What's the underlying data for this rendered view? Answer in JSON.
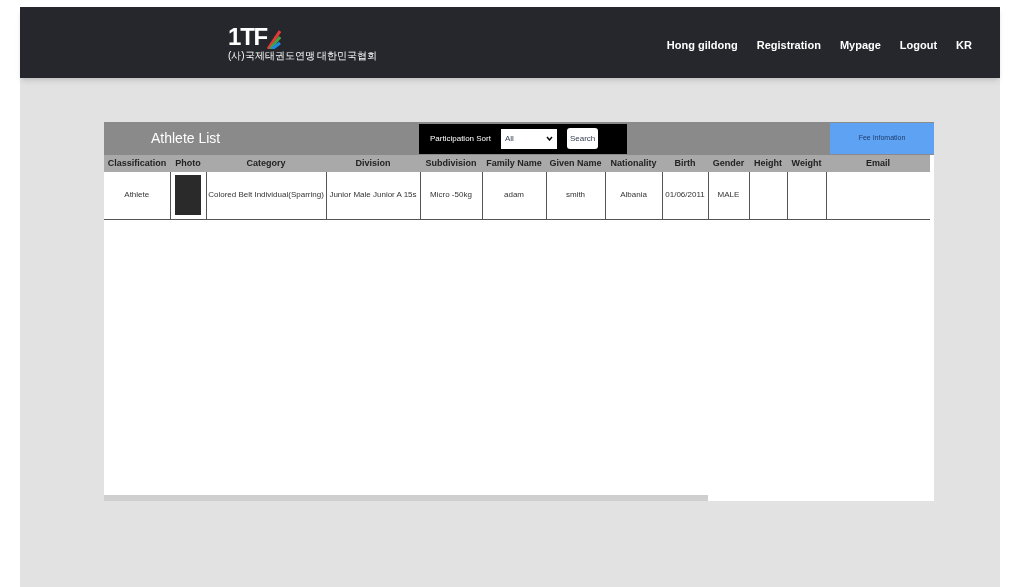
{
  "header": {
    "logo": {
      "text": "1TF",
      "subtitle": "(사)국제태권도연맹 대한민국협회"
    },
    "nav": [
      "Hong gildong",
      "Registration",
      "Mypage",
      "Logout",
      "KR"
    ]
  },
  "panel": {
    "title": "Athlete List",
    "sort": {
      "label": "Participation Sort",
      "value": "All",
      "button": "Search"
    },
    "fee_button": "Fee Infomation"
  },
  "table": {
    "columns": [
      "Classification",
      "Photo",
      "Category",
      "Division",
      "Subdivision",
      "Family Name",
      "Given Name",
      "Nationality",
      "Birth",
      "Gender",
      "Height",
      "Weight",
      "Email"
    ],
    "rows": [
      {
        "classification": "Athlete",
        "category": "Colored Belt Individual(Sparring)",
        "division": "Junior Male Junior A 15s",
        "subdivision": "Micro -50kg",
        "family_name": "adam",
        "given_name": "smith",
        "nationality": "Albania",
        "birth": "01/06/2011",
        "gender": "MALE"
      }
    ]
  }
}
